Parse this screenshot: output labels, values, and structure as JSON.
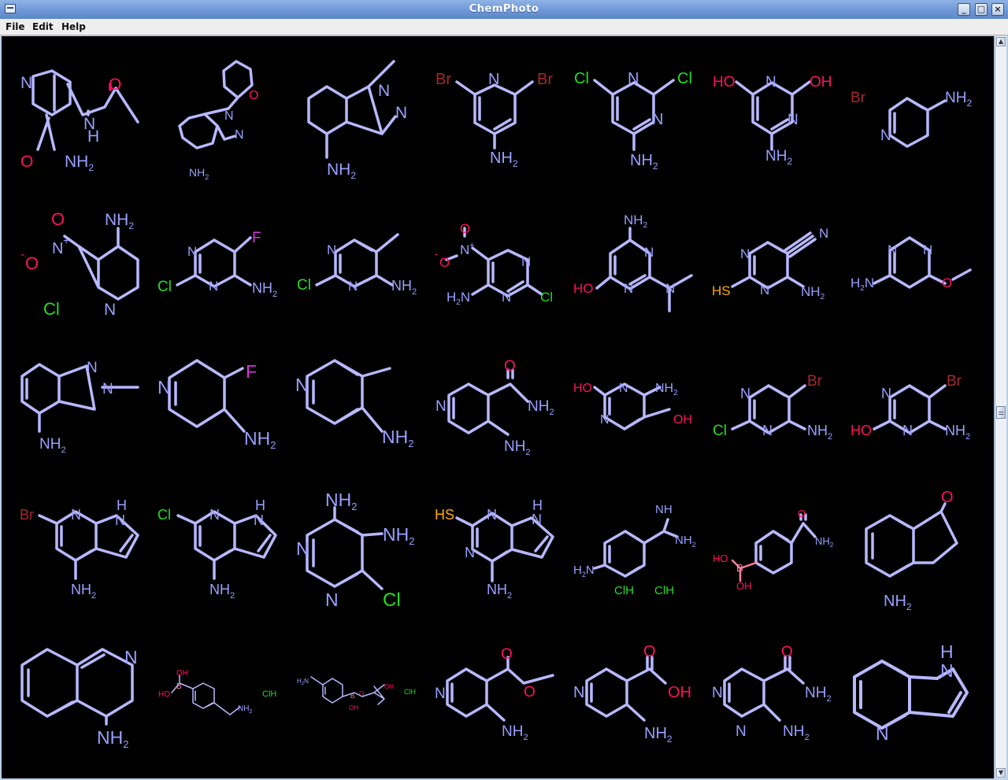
{
  "window": {
    "title": "ChemPhoto"
  },
  "menu": [
    "File",
    "Edit",
    "Help"
  ],
  "colors": {
    "bond": "#b8b8ff",
    "n": "#9aa0ff",
    "o": "#ff1060",
    "cl": "#22dd22",
    "br": "#a52a2a",
    "f": "#dd33dd",
    "s": "#ffaa00",
    "b": "#ff7fa0"
  },
  "mol": {
    "m01": {
      "n": "N",
      "o1": "O",
      "nh": "N",
      "h": "H",
      "o2": "O",
      "nh2": "NH",
      "sub": "2"
    },
    "m02": {
      "o": "O",
      "n1": "N",
      "n2": "N",
      "nh2": "NH",
      "sub": "2"
    },
    "m03": {
      "n1": "N",
      "n2": "N",
      "nh2": "NH",
      "sub": "2"
    },
    "m04": {
      "br1": "Br",
      "n": "N",
      "br2": "Br",
      "nh2": "NH",
      "sub": "2"
    },
    "m05": {
      "cl1": "Cl",
      "n1": "N",
      "cl2": "Cl",
      "n2": "N",
      "nh2": "NH",
      "sub": "2"
    },
    "m06": {
      "ho": "HO",
      "n1": "N",
      "oh": "OH",
      "n2": "N",
      "nh2": "NH",
      "sub": "2"
    },
    "m07": {
      "br": "Br",
      "n": "N",
      "nh2": "NH",
      "sub": "2"
    },
    "m08": {
      "minus": "-",
      "o1": "O",
      "nplus": "N",
      "plus": "+",
      "o2": "O",
      "nh2": "NH",
      "sub": "2",
      "n": "N",
      "cl": "Cl"
    },
    "m09": {
      "f": "F",
      "n1": "N",
      "n2": "N",
      "cl": "Cl",
      "nh2": "NH",
      "sub": "2"
    },
    "m10": {
      "n1": "N",
      "n2": "N",
      "cl": "Cl",
      "nh2": "NH",
      "sub": "2"
    },
    "m11": {
      "o1": "O",
      "nplus": "N",
      "plus": "+",
      "minus": "-",
      "o2": "O",
      "n1": "N",
      "n2": "N",
      "h2n": "H",
      "sub": "2",
      "nn": "N",
      "cl": "Cl"
    },
    "m12": {
      "nh2": "NH",
      "sub": "2",
      "n1": "N",
      "n2": "N",
      "ho": "HO",
      "n3": "N"
    },
    "m13": {
      "n1": "N",
      "n2": "N",
      "hs": "HS",
      "nh2": "NH",
      "sub": "2",
      "cn": "N"
    },
    "m14": {
      "n1": "N",
      "n2": "N",
      "h2n": "H",
      "sub": "2",
      "nn": "N",
      "o": "O"
    },
    "m15": {
      "n1": "N",
      "n2": "N",
      "nh2": "NH",
      "sub": "2"
    },
    "m16": {
      "n": "N",
      "f": "F",
      "nh2": "NH",
      "sub": "2"
    },
    "m17": {
      "n": "N",
      "nh2": "NH",
      "sub": "2"
    },
    "m18": {
      "o": "O",
      "n": "N",
      "nh2a": "NH",
      "sub": "2",
      "nh2b": "NH"
    },
    "m19": {
      "ho": "HO",
      "n1": "N",
      "nh2": "NH",
      "sub": "2",
      "n2": "N",
      "oh": "OH"
    },
    "m20": {
      "br": "Br",
      "n1": "N",
      "cl": "Cl",
      "n2": "N",
      "nh2": "NH",
      "sub": "2"
    },
    "m21": {
      "br": "Br",
      "n1": "N",
      "ho": "HO",
      "n2": "N",
      "nh2": "NH",
      "sub": "2"
    },
    "m22": {
      "br": "Br",
      "n": "N",
      "h": "H",
      "nn": "N",
      "nh2": "NH",
      "sub": "2"
    },
    "m23": {
      "cl": "Cl",
      "n": "N",
      "h": "H",
      "nn": "N",
      "nh2": "NH",
      "sub": "2"
    },
    "m24": {
      "nh2a": "NH",
      "sub": "2",
      "nh2b": "NH",
      "n1": "N",
      "n2": "N",
      "cl": "Cl"
    },
    "m25": {
      "hs": "HS",
      "n1": "N",
      "h": "H",
      "nn": "N",
      "n2": "N",
      "nh2": "NH",
      "sub": "2"
    },
    "m26": {
      "nh": "NH",
      "nh2": "NH",
      "sub": "2",
      "h2n": "H",
      "n": "N",
      "clh1": "ClH",
      "clh2": "ClH"
    },
    "m27": {
      "o": "O",
      "nh2": "NH",
      "sub": "2",
      "ho": "HO",
      "b": "B",
      "oh": "OH"
    },
    "m28": {
      "o": "O",
      "nh2": "NH",
      "sub": "2"
    },
    "m29": {
      "n": "N",
      "nh2": "NH",
      "sub": "2"
    },
    "m30": {
      "oh1": "OH",
      "ho": "HO",
      "b": "B",
      "nh2": "NH",
      "sub": "2",
      "clh": "ClH"
    },
    "m31": {
      "h2n": "H",
      "sub": "2",
      "nn": "N",
      "b": "B",
      "o": "O",
      "oh": "OH",
      "oh2": "OH",
      "clh": "ClH"
    },
    "m32": {
      "o1": "O",
      "n": "N",
      "o2": "O",
      "nh2": "NH",
      "sub": "2"
    },
    "m33": {
      "o": "O",
      "n": "N",
      "oh": "OH",
      "nh2": "NH",
      "sub": "2"
    },
    "m34": {
      "o": "O",
      "n1": "N",
      "nh2a": "NH",
      "sub": "2",
      "n2": "N",
      "nh2b": "NH"
    },
    "m35": {
      "h": "H",
      "n1": "N",
      "n2": "N"
    }
  }
}
